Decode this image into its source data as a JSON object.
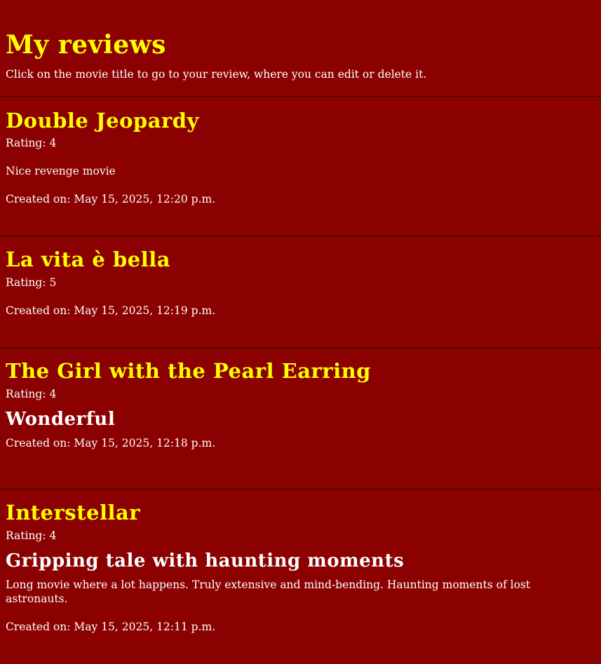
{
  "header": {
    "title": "My reviews",
    "subtitle": "Click on the movie title to go to your review, where you can edit or delete it."
  },
  "reviews": [
    {
      "movie_title": "Double Jeopardy",
      "rating_text": "Rating: 4",
      "heading": "",
      "body": "Nice revenge movie",
      "created_text": "Created on: May 15, 2025, 12:20 p.m."
    },
    {
      "movie_title": "La vita è bella",
      "rating_text": "Rating: 5",
      "heading": "",
      "body": "",
      "created_text": "Created on: May 15, 2025, 12:19 p.m."
    },
    {
      "movie_title": "The Girl with the Pearl Earring",
      "rating_text": "Rating: 4",
      "heading": "Wonderful",
      "body": "",
      "created_text": "Created on: May 15, 2025, 12:18 p.m."
    },
    {
      "movie_title": "Interstellar",
      "rating_text": "Rating: 4",
      "heading": "Gripping tale with haunting moments",
      "body": "Long movie where a lot happens. Truly extensive and mind-bending. Haunting moments of lost astronauts.",
      "created_text": "Created on: May 15, 2025, 12:11 p.m."
    }
  ],
  "colors": {
    "background": "#8b0000",
    "title_yellow": "#ffff00",
    "text_white": "#ffffff",
    "divider": "#2a0000"
  }
}
